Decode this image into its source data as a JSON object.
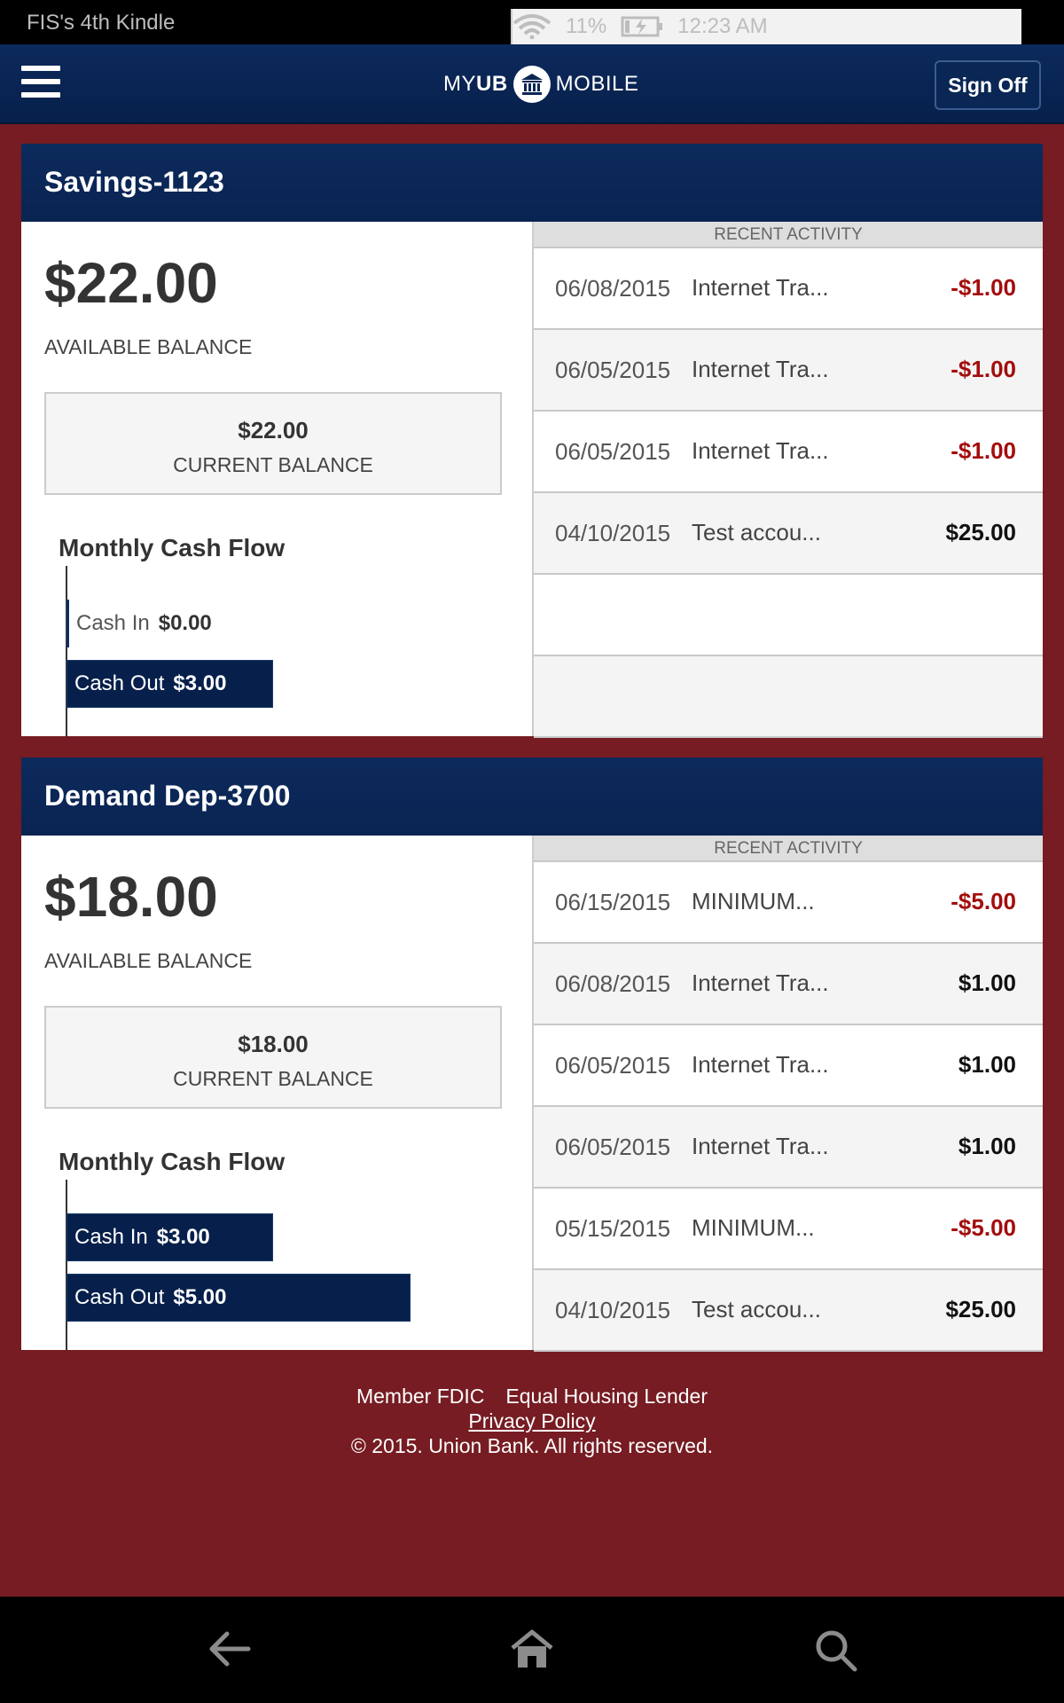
{
  "status_bar": {
    "device_name": "FIS's 4th Kindle",
    "battery": "11%",
    "time": "12:23 AM"
  },
  "header": {
    "logo_my": "MY",
    "logo_ub": "UB",
    "logo_mobile": "MOBILE",
    "sign_off": "Sign Off"
  },
  "accounts": [
    {
      "name": "Savings-1123",
      "available_balance": "$22.00",
      "available_label": "AVAILABLE BALANCE",
      "current_balance": "$22.00",
      "current_label": "CURRENT BALANCE",
      "cash_flow_title": "Monthly Cash Flow",
      "cash_in_label": "Cash In",
      "cash_in": "$0.00",
      "cash_in_value": 0,
      "cash_out_label": "Cash Out",
      "cash_out": "$3.00",
      "cash_out_value": 3,
      "recent_label": "RECENT ACTIVITY",
      "activity": [
        {
          "date": "06/08/2015",
          "desc": "Internet Tra...",
          "amount": "-$1.00",
          "negative": true
        },
        {
          "date": "06/05/2015",
          "desc": "Internet Tra...",
          "amount": "-$1.00",
          "negative": true
        },
        {
          "date": "06/05/2015",
          "desc": "Internet Tra...",
          "amount": "-$1.00",
          "negative": true
        },
        {
          "date": "04/10/2015",
          "desc": "Test accou...",
          "amount": "$25.00",
          "negative": false
        },
        {
          "date": "",
          "desc": "",
          "amount": "",
          "negative": false
        },
        {
          "date": "",
          "desc": "",
          "amount": "",
          "negative": false
        }
      ]
    },
    {
      "name": "Demand Dep-3700",
      "available_balance": "$18.00",
      "available_label": "AVAILABLE BALANCE",
      "current_balance": "$18.00",
      "current_label": "CURRENT BALANCE",
      "cash_flow_title": "Monthly Cash Flow",
      "cash_in_label": "Cash In",
      "cash_in": "$3.00",
      "cash_in_value": 3,
      "cash_out_label": "Cash Out",
      "cash_out": "$5.00",
      "cash_out_value": 5,
      "recent_label": "RECENT ACTIVITY",
      "activity": [
        {
          "date": "06/15/2015",
          "desc": "MINIMUM...",
          "amount": "-$5.00",
          "negative": true
        },
        {
          "date": "06/08/2015",
          "desc": "Internet Tra...",
          "amount": "$1.00",
          "negative": false
        },
        {
          "date": "06/05/2015",
          "desc": "Internet Tra...",
          "amount": "$1.00",
          "negative": false
        },
        {
          "date": "06/05/2015",
          "desc": "Internet Tra...",
          "amount": "$1.00",
          "negative": false
        },
        {
          "date": "05/15/2015",
          "desc": "MINIMUM...",
          "amount": "-$5.00",
          "negative": true
        },
        {
          "date": "04/10/2015",
          "desc": "Test accou...",
          "amount": "$25.00",
          "negative": false
        }
      ]
    }
  ],
  "footer": {
    "member_fdic": "Member FDIC",
    "equal_housing": "Equal Housing Lender",
    "privacy": "Privacy Policy",
    "copyright": "© 2015. Union Bank. All rights reserved."
  },
  "colors": {
    "background": "#761c22",
    "navy": "#07204b",
    "negative": "#a30d0d"
  }
}
